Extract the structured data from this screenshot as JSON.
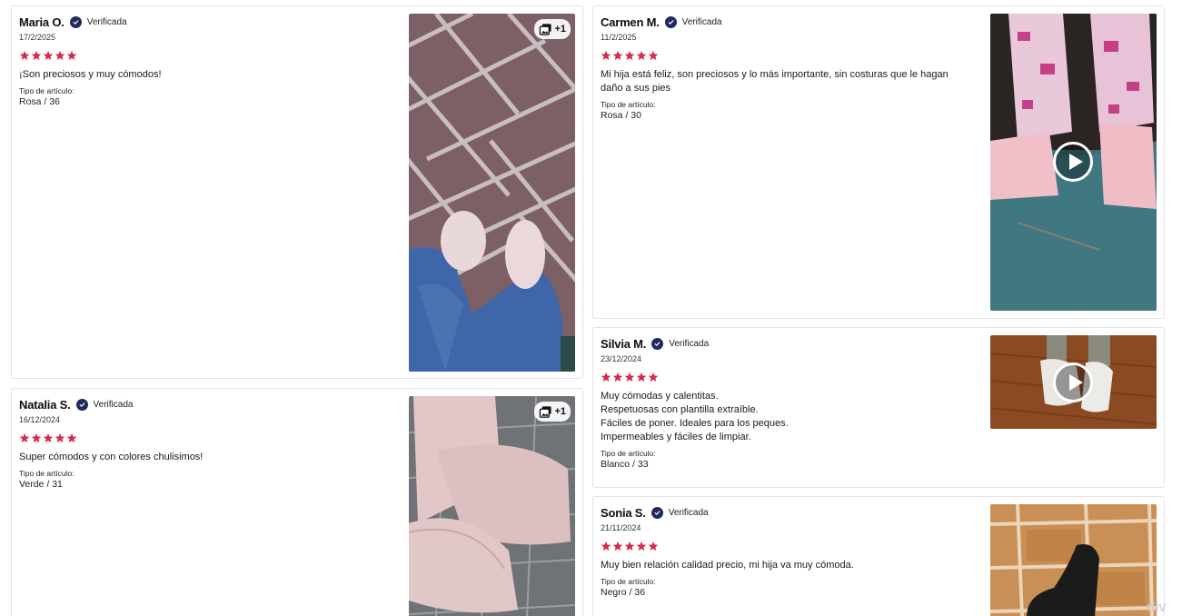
{
  "reviews": [
    {
      "name": "Maria O.",
      "verified": "Verificada",
      "date": "17/2/2025",
      "rating": 5,
      "text": "¡Son preciosos y muy cómodos!",
      "type_label": "Tipo de artículo:",
      "type_value": "Rosa / 36",
      "media_badge": "+1"
    },
    {
      "name": "Natalia S.",
      "verified": "Verificada",
      "date": "16/12/2024",
      "rating": 5,
      "text": "Super cómodos y con colores chulisimos!",
      "type_label": "Tipo de artículo:",
      "type_value": "Verde / 31",
      "media_badge": "+1"
    },
    {
      "name": "Carmen M.",
      "verified": "Verificada",
      "date": "11/2/2025",
      "rating": 5,
      "text": "Mi hija está feliz, son preciosos y lo más importante, sin costuras que le hagan daño a sus pies",
      "type_label": "Tipo de artículo:",
      "type_value": "Rosa / 30"
    },
    {
      "name": "Silvia M.",
      "verified": "Verificada",
      "date": "23/12/2024",
      "rating": 5,
      "text": "Muy cómodas y calentitas.\nRespetuosas con plantilla extraíble.\nFáciles de poner. Ideales para los peques.\nImpermeables y fáciles de limpiar.",
      "type_label": "Tipo de artículo:",
      "type_value": "Blanco / 33"
    },
    {
      "name": "Sonia S.",
      "verified": "Verificada",
      "date": "21/11/2024",
      "rating": 5,
      "text": "Muy bien relación calidad precio, mi hija va muy cómoda.",
      "type_label": "Tipo de artículo:",
      "type_value": "Negro / 36"
    }
  ],
  "colors": {
    "star": "#d62a4e",
    "verified_badge": "#1f2a5a",
    "border": "#e3e3e3"
  },
  "watermark": "rtiv"
}
